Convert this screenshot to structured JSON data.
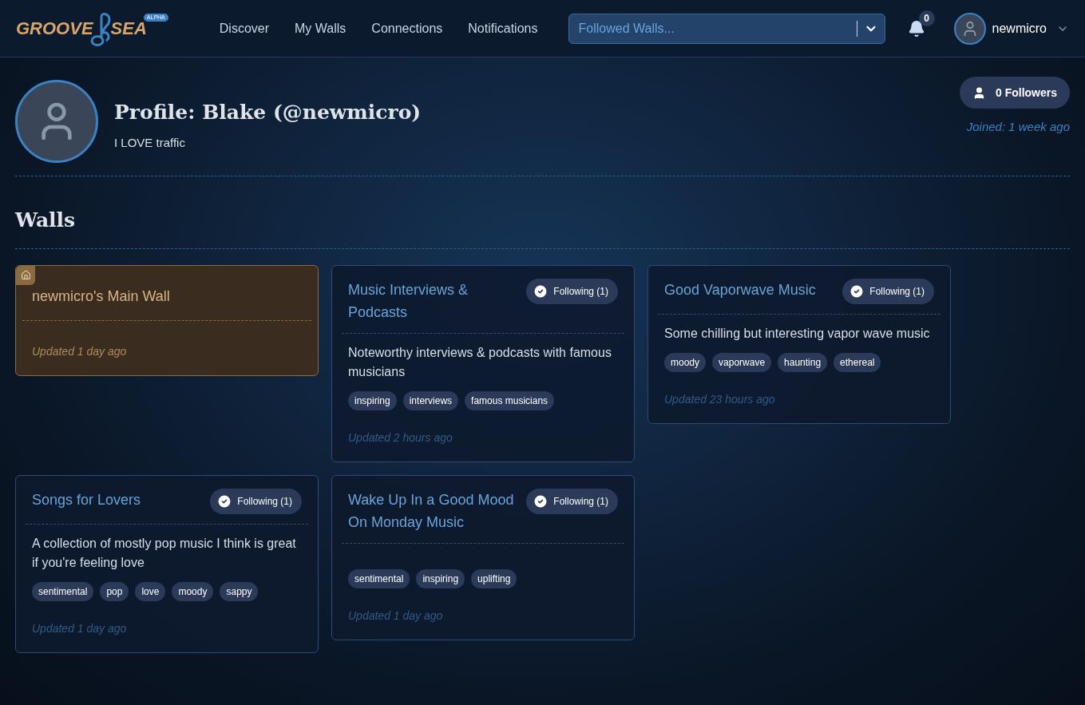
{
  "header": {
    "logo": {
      "word_1": "GROOVE",
      "word_2": "SEA",
      "badge": "ALPHA"
    },
    "nav": [
      {
        "label": "Discover"
      },
      {
        "label": "My Walls"
      },
      {
        "label": "Connections"
      },
      {
        "label": "Notifications"
      }
    ],
    "wall_picker": {
      "placeholder": "Followed Walls..."
    },
    "notifications": {
      "count": "0"
    },
    "user": {
      "name": "newmicro"
    }
  },
  "profile": {
    "title": "Profile: Blake (@newmicro)",
    "bio": "I LOVE traffic",
    "followers": "0 Followers",
    "joined": "Joined: 1 week ago"
  },
  "walls_heading": "Walls",
  "walls": [
    {
      "kind": "main",
      "title": "newmicro's Main Wall",
      "updated": "Updated 1 day ago"
    },
    {
      "kind": "followed",
      "title": "Music Interviews & Podcasts",
      "follow_label": "Following (1)",
      "description": "Noteworthy interviews & podcasts with famous musicians",
      "tags": [
        "inspiring",
        "interviews",
        "famous musicians"
      ],
      "updated": "Updated 2 hours ago"
    },
    {
      "kind": "followed",
      "title": "Good Vaporwave Music",
      "follow_label": "Following (1)",
      "description": "Some chilling but interesting vapor wave music",
      "tags": [
        "moody",
        "vaporwave",
        "haunting",
        "ethereal"
      ],
      "updated": "Updated 23 hours ago"
    },
    {
      "kind": "followed",
      "title": "Songs for Lovers",
      "follow_label": "Following (1)",
      "description": "A collection of mostly pop music I think is great if you're feeling love",
      "tags": [
        "sentimental",
        "pop",
        "love",
        "moody",
        "sappy"
      ],
      "updated": "Updated 1 day ago"
    },
    {
      "kind": "followed",
      "title": "Wake Up In a Good Mood On Monday Music",
      "follow_label": "Following (1)",
      "tags": [
        "sentimental",
        "inspiring",
        "uplifting"
      ],
      "updated": "Updated 1 day ago"
    }
  ]
}
